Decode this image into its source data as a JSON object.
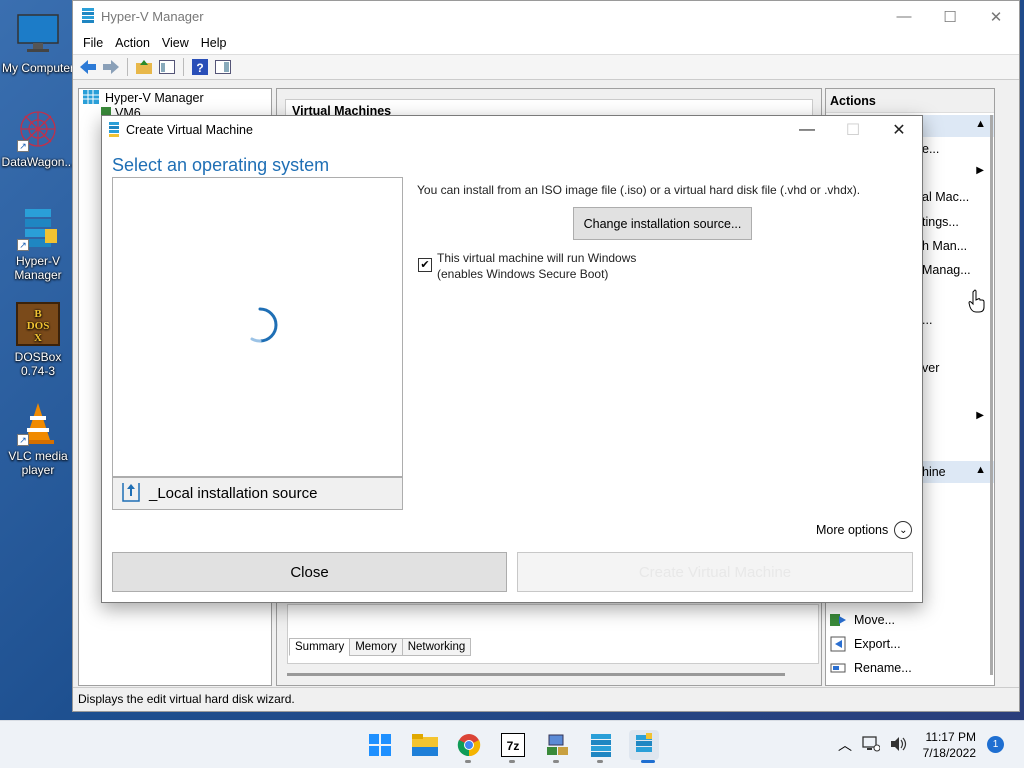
{
  "desktop": {
    "icons": [
      {
        "label": "My Computer",
        "icon": "monitor-icon"
      },
      {
        "label": "DataWagon...",
        "icon": "datawagon-icon"
      },
      {
        "label": "Hyper-V Manager",
        "icon": "hyperv-icon"
      },
      {
        "label": "DOSBox 0.74-3",
        "icon": "dosbox-icon"
      },
      {
        "label": "VLC media player",
        "icon": "vlc-cone-icon"
      }
    ]
  },
  "hyperv": {
    "title": "Hyper-V Manager",
    "menu": [
      "File",
      "Action",
      "View",
      "Help"
    ],
    "tree": {
      "root": "Hyper-V Manager",
      "child": "VM6"
    },
    "center": {
      "header": "Virtual Machines",
      "tabs": [
        "Summary",
        "Memory",
        "Networking"
      ]
    },
    "actions": {
      "header": "Actions",
      "partial_items": [
        "e...",
        "al Mac...",
        "tings...",
        "h Man...",
        "Manag...",
        "...",
        "ver",
        "hine"
      ],
      "items": [
        "Move...",
        "Export...",
        "Rename..."
      ]
    },
    "status": "Displays the edit virtual hard disk wizard."
  },
  "dialog": {
    "title": "Create Virtual Machine",
    "heading": "Select an operating system",
    "local_source": "_Local installation source",
    "install_text": "You can install from an ISO image file (.iso) or a virtual hard disk file (.vhd or .vhdx).",
    "change_source_button": "Change installation source...",
    "windows_checkbox": {
      "line1": "This virtual machine will run Windows",
      "line2": "(enables Windows Secure Boot)",
      "checked": true
    },
    "more_options": "More options",
    "close_button": "Close",
    "create_button": "Create Virtual Machine"
  },
  "taskbar": {
    "apps": [
      "windows-start-icon",
      "file-explorer-icon",
      "chrome-icon",
      "7zip-icon",
      "network-app-icon",
      "hyperv-taskbar-icon",
      "hyperv-vm-taskbar-icon"
    ],
    "time": "11:17 PM",
    "date": "7/18/2022",
    "notifications": "1"
  },
  "colors": {
    "accent": "#1f6fb5",
    "taskbar": "#eef2f7"
  }
}
